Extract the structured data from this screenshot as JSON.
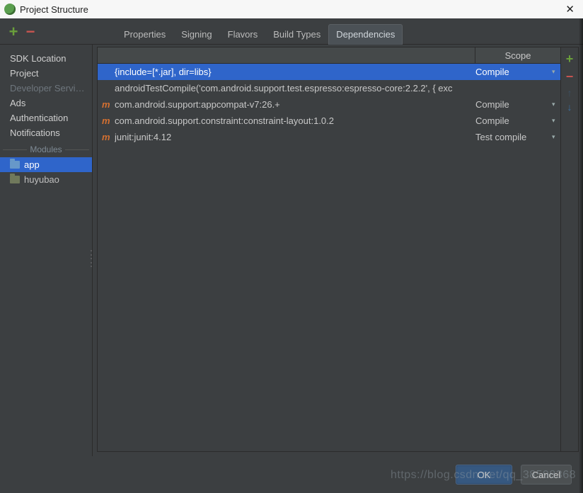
{
  "window": {
    "title": "Project Structure"
  },
  "toolbar": {
    "add": "+",
    "remove": "−"
  },
  "tabs": [
    {
      "label": "Properties",
      "active": false
    },
    {
      "label": "Signing",
      "active": false
    },
    {
      "label": "Flavors",
      "active": false
    },
    {
      "label": "Build Types",
      "active": false
    },
    {
      "label": "Dependencies",
      "active": true
    }
  ],
  "sidebar": {
    "items": [
      {
        "label": "SDK Location"
      },
      {
        "label": "Project"
      },
      {
        "label": "Developer Servi…",
        "disabled": true
      },
      {
        "label": "Ads"
      },
      {
        "label": "Authentication"
      },
      {
        "label": "Notifications"
      }
    ],
    "modules_header": "Modules",
    "modules": [
      {
        "label": "app",
        "selected": true
      },
      {
        "label": "huyubao",
        "selected": false
      }
    ]
  },
  "dep_header": {
    "scope": "Scope"
  },
  "dependencies": [
    {
      "icon": "",
      "text": "{include=[*.jar], dir=libs}",
      "scope": "Compile",
      "dd": "▾",
      "selected": true
    },
    {
      "icon": "",
      "text": "androidTestCompile('com.android.support.test.espresso:espresso-core:2.2.2', {     exc",
      "scope": "",
      "dd": "",
      "selected": false
    },
    {
      "icon": "m",
      "text": "com.android.support:appcompat-v7:26.+",
      "scope": "Compile",
      "dd": "▾",
      "selected": false
    },
    {
      "icon": "m",
      "text": "com.android.support.constraint:constraint-layout:1.0.2",
      "scope": "Compile",
      "dd": "▾",
      "selected": false
    },
    {
      "icon": "m",
      "text": "junit:junit:4.12",
      "scope": "Test compile",
      "dd": "▾",
      "selected": false
    }
  ],
  "side_actions": {
    "add": "+",
    "remove": "−",
    "up": "↑",
    "down": "↓"
  },
  "footer": {
    "ok": "OK",
    "cancel": "Cancel"
  },
  "watermark": "https://blog.csdn.net/qq_38598368"
}
